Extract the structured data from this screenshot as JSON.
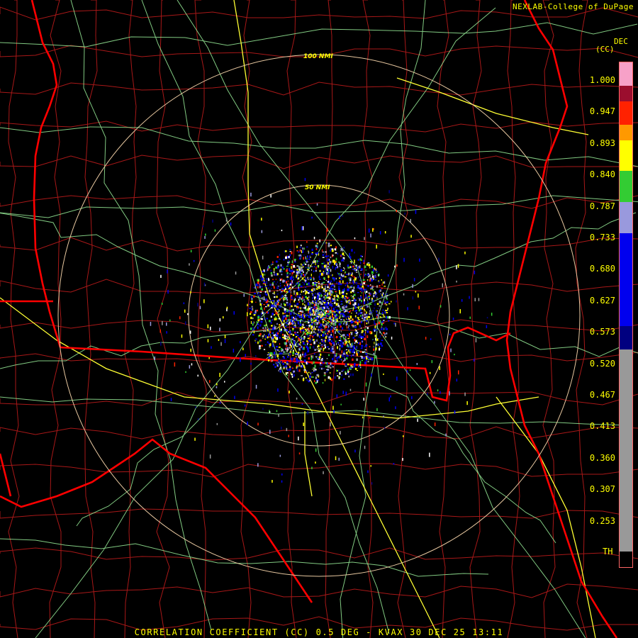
{
  "header": {
    "credit": "NEXLAB-College of DuPage",
    "units_top": "DEC",
    "units_bottom": "(CC)"
  },
  "footer": {
    "caption": "CORRELATION COEFFICIENT (CC) 0.5 DEG - KVAX 30 DEC 25 13:11"
  },
  "range_rings": [
    {
      "label": "100 NMI"
    },
    {
      "label": "50 NMI"
    }
  ],
  "colorbar": {
    "ticks": [
      "1.000",
      "0.947",
      "0.893",
      "0.840",
      "0.787",
      "0.733",
      "0.680",
      "0.627",
      "0.573",
      "0.520",
      "0.467",
      "0.413",
      "0.360",
      "0.307",
      "0.253"
    ],
    "bottom_label": "TH",
    "colors": {
      "pink": "#f7a1c8",
      "dark_red": "#9b0e2e",
      "red": "#ff2200",
      "orange": "#ff9900",
      "yellow": "#ffff00",
      "green": "#33cc33",
      "light_blue": "#9999dd",
      "blue": "#0000ee",
      "navy": "#000080",
      "gray": "#999999"
    }
  },
  "map_colors": {
    "state": "#ff0000",
    "county": "#b01818",
    "highway": "#ffff33",
    "road": "#99ee99",
    "ring": "#e8c8a0"
  }
}
